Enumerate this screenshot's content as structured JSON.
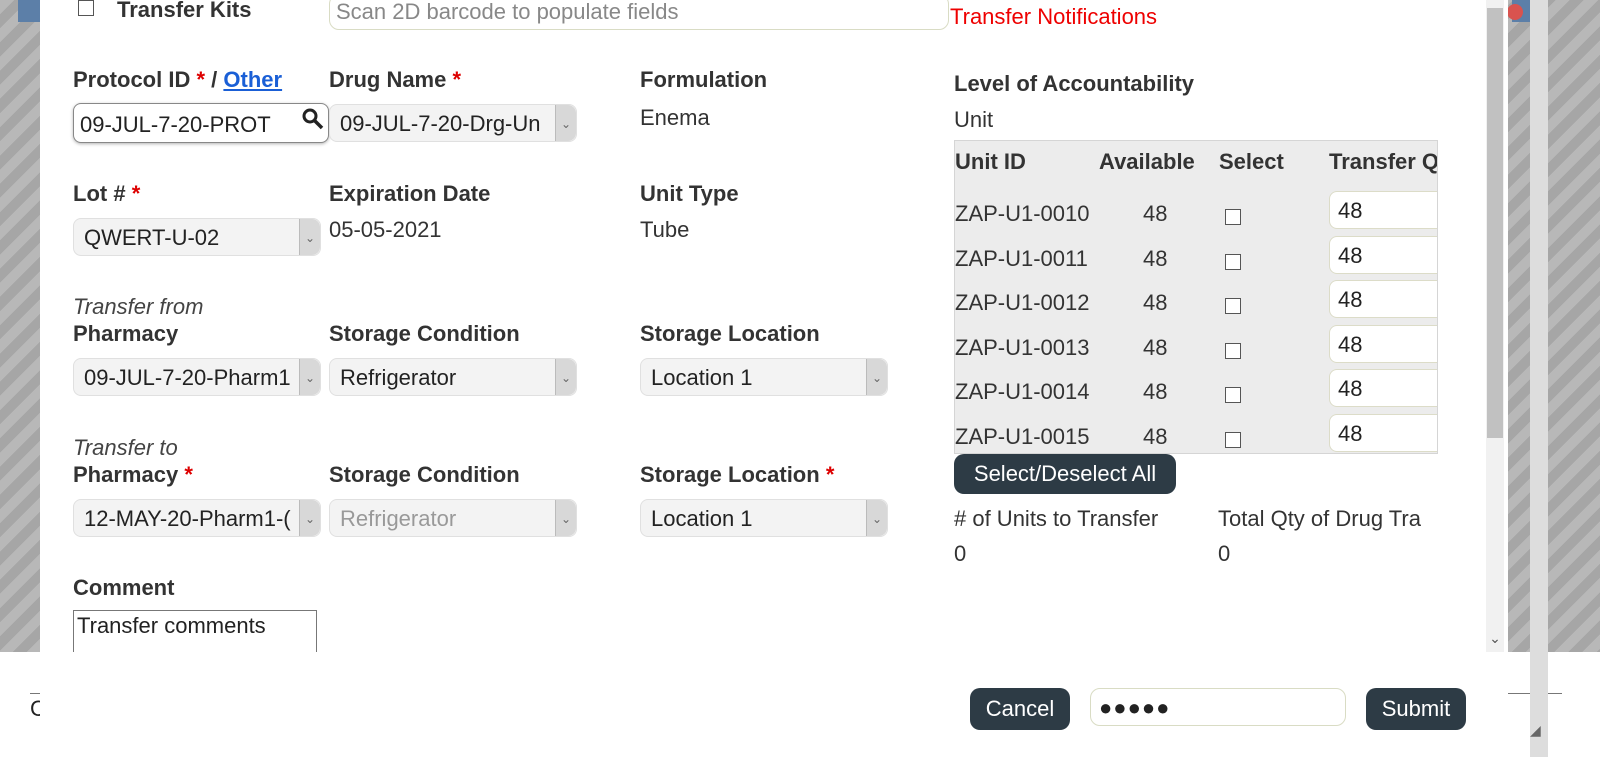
{
  "header": {
    "transfer_kits_label": "Transfer Kits",
    "scan_placeholder": "Scan 2D barcode to populate fields",
    "notifications_link": "Transfer Notifications"
  },
  "protocol": {
    "label": "Protocol ID",
    "required": "*",
    "separator": "/",
    "other_link": "Other",
    "value": "09-JUL-7-20-PROT"
  },
  "drug": {
    "label": "Drug Name",
    "required": "*",
    "value": "09-JUL-7-20-Drg-Un"
  },
  "formulation": {
    "label": "Formulation",
    "value": "Enema"
  },
  "accountability": {
    "label": "Level of Accountability",
    "value": "Unit"
  },
  "lot": {
    "label": "Lot #",
    "required": "*",
    "value": "QWERT-U-02"
  },
  "expiration": {
    "label": "Expiration Date",
    "value": "05-05-2021"
  },
  "unit_type": {
    "label": "Unit Type",
    "value": "Tube"
  },
  "transfer_from": {
    "heading": "Transfer from",
    "pharmacy_label": "Pharmacy",
    "pharmacy_value": "09-JUL-7-20-Pharm1",
    "storage_condition_label": "Storage Condition",
    "storage_condition_value": "Refrigerator",
    "storage_location_label": "Storage Location",
    "storage_location_value": "Location 1"
  },
  "transfer_to": {
    "heading": "Transfer to",
    "pharmacy_label": "Pharmacy",
    "pharmacy_required": "*",
    "pharmacy_value": "12-MAY-20-Pharm1-(",
    "storage_condition_label": "Storage Condition",
    "storage_condition_value": "Refrigerator",
    "storage_location_label": "Storage Location",
    "storage_location_required": "*",
    "storage_location_value": "Location 1"
  },
  "comment": {
    "label": "Comment",
    "value": "Transfer comments"
  },
  "units_table": {
    "headers": [
      "Unit ID",
      "Available",
      "Select",
      "Transfer Q"
    ],
    "rows": [
      {
        "unit_id": "ZAP-U1-0010",
        "available": "48",
        "qty": "48"
      },
      {
        "unit_id": "ZAP-U1-0011",
        "available": "48",
        "qty": "48"
      },
      {
        "unit_id": "ZAP-U1-0012",
        "available": "48",
        "qty": "48"
      },
      {
        "unit_id": "ZAP-U1-0013",
        "available": "48",
        "qty": "48"
      },
      {
        "unit_id": "ZAP-U1-0014",
        "available": "48",
        "qty": "48"
      },
      {
        "unit_id": "ZAP-U1-0015",
        "available": "48",
        "qty": "48"
      }
    ],
    "select_all_label": "Select/Deselect All"
  },
  "totals": {
    "units_label": "# of Units to Transfer",
    "units_value": "0",
    "qty_label": "Total Qty of Drug Tra",
    "qty_value": "0"
  },
  "footer": {
    "cancel_label": "Cancel",
    "password_value": "●●●●●",
    "submit_label": "Submit"
  },
  "background": {
    "letter": "C"
  }
}
